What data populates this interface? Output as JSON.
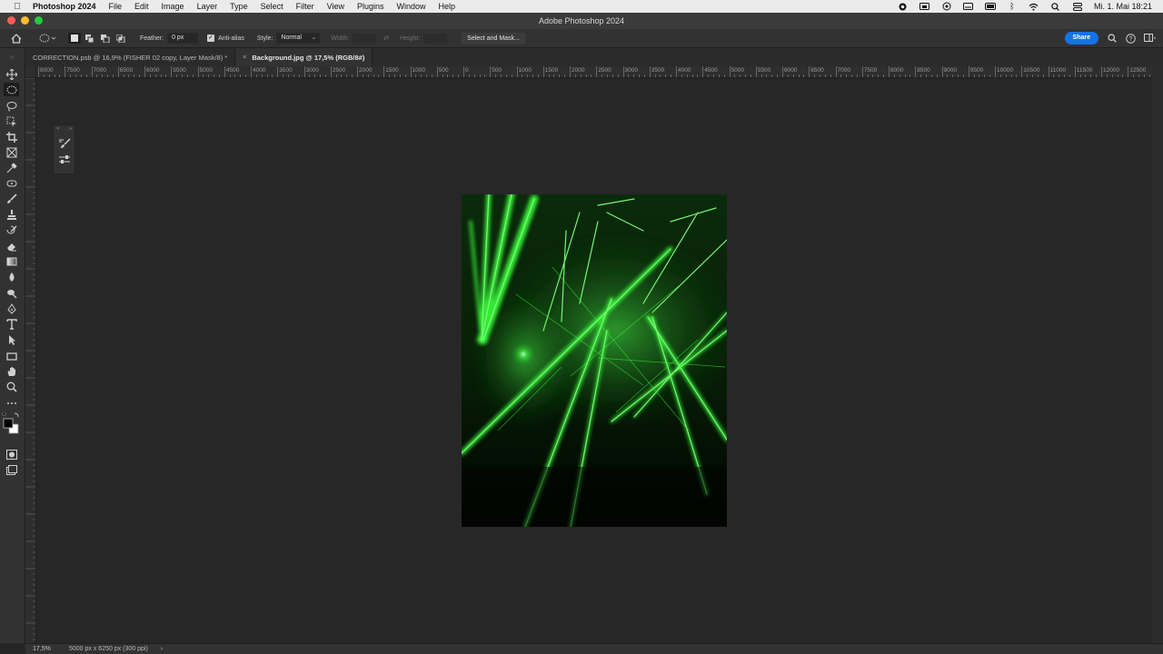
{
  "menubar": {
    "app_name": "Photoshop 2024",
    "items": [
      "File",
      "Edit",
      "Image",
      "Layer",
      "Type",
      "Select",
      "Filter",
      "View",
      "Plugins",
      "Window",
      "Help"
    ],
    "clock": "Mi. 1. Mai  18:21"
  },
  "window": {
    "title": "Adobe Photoshop 2024"
  },
  "options": {
    "feather_label": "Feather:",
    "feather_value": "0 px",
    "anti_alias_label": "Anti-alias",
    "style_label": "Style:",
    "style_value": "Normal",
    "width_label": "Width:",
    "height_label": "Height:",
    "select_and_mask_label": "Select and Mask...",
    "share_label": "Share"
  },
  "tabs": [
    {
      "label": "CORRECTION.psb @ 16,9% (FISHER 02 copy, Layer Mask/8) *",
      "active": false
    },
    {
      "label": "Background.jpg @ 17,5% (RGB/8#)",
      "active": true
    }
  ],
  "rulers": {
    "horizontal": [
      "8000",
      "7500",
      "7000",
      "6500",
      "6000",
      "5500",
      "5000",
      "4500",
      "4000",
      "3500",
      "3000",
      "2500",
      "2000",
      "1500",
      "1000",
      "500",
      "0",
      "500",
      "1000",
      "1500",
      "2000",
      "2500",
      "3000",
      "3500",
      "4000",
      "4500",
      "5000",
      "5500",
      "6000",
      "6500",
      "7000",
      "7500",
      "8000",
      "8500",
      "9000",
      "9500",
      "10000",
      "10500",
      "11000",
      "11500",
      "12000",
      "12500"
    ]
  },
  "status": {
    "zoom": "17,5%",
    "doc_info": "5000 px x 6250 px (300 ppi)",
    "arrow": "›"
  },
  "colors": {
    "accent": "#1473e6",
    "laser_green": "#3bff3b"
  }
}
